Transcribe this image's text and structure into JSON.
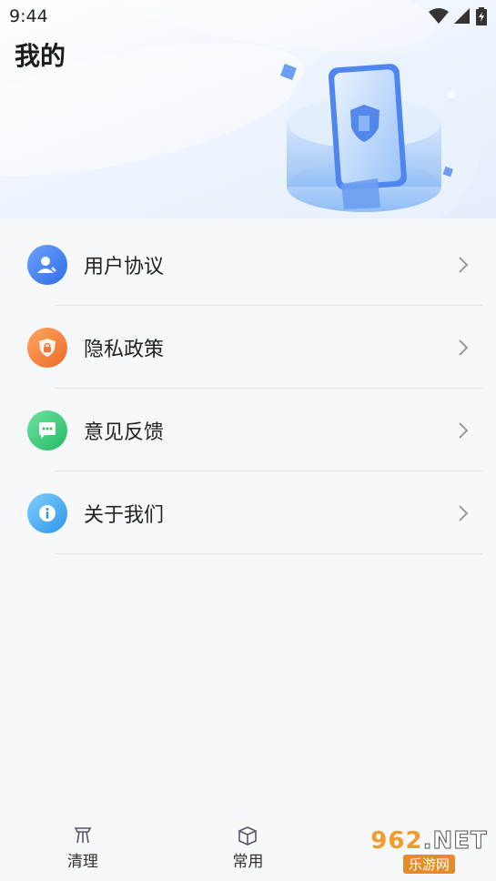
{
  "status_bar": {
    "time": "9:44",
    "icons": [
      "wifi-icon",
      "signal-icon",
      "battery-charging-icon"
    ]
  },
  "header": {
    "title": "我的"
  },
  "menu": {
    "items": [
      {
        "label": "用户协议",
        "icon": "user-icon",
        "color": "#4a82f0"
      },
      {
        "label": "隐私政策",
        "icon": "lock-icon",
        "color": "#f47f3a"
      },
      {
        "label": "意见反馈",
        "icon": "chat-icon",
        "color": "#3fc97a"
      },
      {
        "label": "关于我们",
        "icon": "info-icon",
        "color": "#3aa3ef"
      }
    ]
  },
  "tabbar": {
    "tabs": [
      {
        "label": "清理",
        "icon": "broom-icon"
      },
      {
        "label": "常用",
        "icon": "box-icon"
      }
    ]
  },
  "watermark": {
    "top": "962",
    "net": ".NET",
    "bottom": "乐游网"
  },
  "colors": {
    "background": "#f7f8fa",
    "accent": "#4a82f0"
  }
}
